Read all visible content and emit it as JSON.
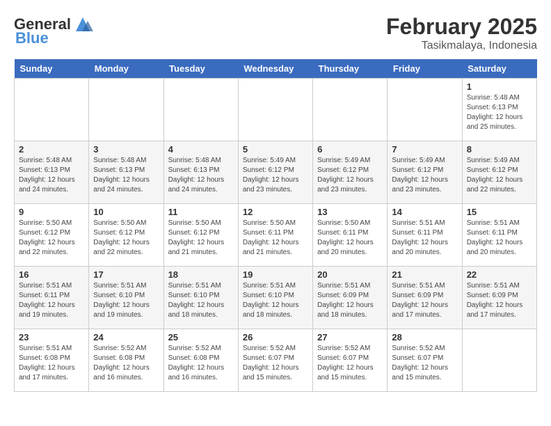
{
  "header": {
    "logo_general": "General",
    "logo_blue": "Blue",
    "month": "February 2025",
    "location": "Tasikmalaya, Indonesia"
  },
  "days_of_week": [
    "Sunday",
    "Monday",
    "Tuesday",
    "Wednesday",
    "Thursday",
    "Friday",
    "Saturday"
  ],
  "weeks": [
    [
      {
        "day": "",
        "info": ""
      },
      {
        "day": "",
        "info": ""
      },
      {
        "day": "",
        "info": ""
      },
      {
        "day": "",
        "info": ""
      },
      {
        "day": "",
        "info": ""
      },
      {
        "day": "",
        "info": ""
      },
      {
        "day": "1",
        "info": "Sunrise: 5:48 AM\nSunset: 6:13 PM\nDaylight: 12 hours\nand 25 minutes."
      }
    ],
    [
      {
        "day": "2",
        "info": "Sunrise: 5:48 AM\nSunset: 6:13 PM\nDaylight: 12 hours\nand 24 minutes."
      },
      {
        "day": "3",
        "info": "Sunrise: 5:48 AM\nSunset: 6:13 PM\nDaylight: 12 hours\nand 24 minutes."
      },
      {
        "day": "4",
        "info": "Sunrise: 5:48 AM\nSunset: 6:13 PM\nDaylight: 12 hours\nand 24 minutes."
      },
      {
        "day": "5",
        "info": "Sunrise: 5:49 AM\nSunset: 6:12 PM\nDaylight: 12 hours\nand 23 minutes."
      },
      {
        "day": "6",
        "info": "Sunrise: 5:49 AM\nSunset: 6:12 PM\nDaylight: 12 hours\nand 23 minutes."
      },
      {
        "day": "7",
        "info": "Sunrise: 5:49 AM\nSunset: 6:12 PM\nDaylight: 12 hours\nand 23 minutes."
      },
      {
        "day": "8",
        "info": "Sunrise: 5:49 AM\nSunset: 6:12 PM\nDaylight: 12 hours\nand 22 minutes."
      }
    ],
    [
      {
        "day": "9",
        "info": "Sunrise: 5:50 AM\nSunset: 6:12 PM\nDaylight: 12 hours\nand 22 minutes."
      },
      {
        "day": "10",
        "info": "Sunrise: 5:50 AM\nSunset: 6:12 PM\nDaylight: 12 hours\nand 22 minutes."
      },
      {
        "day": "11",
        "info": "Sunrise: 5:50 AM\nSunset: 6:12 PM\nDaylight: 12 hours\nand 21 minutes."
      },
      {
        "day": "12",
        "info": "Sunrise: 5:50 AM\nSunset: 6:11 PM\nDaylight: 12 hours\nand 21 minutes."
      },
      {
        "day": "13",
        "info": "Sunrise: 5:50 AM\nSunset: 6:11 PM\nDaylight: 12 hours\nand 20 minutes."
      },
      {
        "day": "14",
        "info": "Sunrise: 5:51 AM\nSunset: 6:11 PM\nDaylight: 12 hours\nand 20 minutes."
      },
      {
        "day": "15",
        "info": "Sunrise: 5:51 AM\nSunset: 6:11 PM\nDaylight: 12 hours\nand 20 minutes."
      }
    ],
    [
      {
        "day": "16",
        "info": "Sunrise: 5:51 AM\nSunset: 6:11 PM\nDaylight: 12 hours\nand 19 minutes."
      },
      {
        "day": "17",
        "info": "Sunrise: 5:51 AM\nSunset: 6:10 PM\nDaylight: 12 hours\nand 19 minutes."
      },
      {
        "day": "18",
        "info": "Sunrise: 5:51 AM\nSunset: 6:10 PM\nDaylight: 12 hours\nand 18 minutes."
      },
      {
        "day": "19",
        "info": "Sunrise: 5:51 AM\nSunset: 6:10 PM\nDaylight: 12 hours\nand 18 minutes."
      },
      {
        "day": "20",
        "info": "Sunrise: 5:51 AM\nSunset: 6:09 PM\nDaylight: 12 hours\nand 18 minutes."
      },
      {
        "day": "21",
        "info": "Sunrise: 5:51 AM\nSunset: 6:09 PM\nDaylight: 12 hours\nand 17 minutes."
      },
      {
        "day": "22",
        "info": "Sunrise: 5:51 AM\nSunset: 6:09 PM\nDaylight: 12 hours\nand 17 minutes."
      }
    ],
    [
      {
        "day": "23",
        "info": "Sunrise: 5:51 AM\nSunset: 6:08 PM\nDaylight: 12 hours\nand 17 minutes."
      },
      {
        "day": "24",
        "info": "Sunrise: 5:52 AM\nSunset: 6:08 PM\nDaylight: 12 hours\nand 16 minutes."
      },
      {
        "day": "25",
        "info": "Sunrise: 5:52 AM\nSunset: 6:08 PM\nDaylight: 12 hours\nand 16 minutes."
      },
      {
        "day": "26",
        "info": "Sunrise: 5:52 AM\nSunset: 6:07 PM\nDaylight: 12 hours\nand 15 minutes."
      },
      {
        "day": "27",
        "info": "Sunrise: 5:52 AM\nSunset: 6:07 PM\nDaylight: 12 hours\nand 15 minutes."
      },
      {
        "day": "28",
        "info": "Sunrise: 5:52 AM\nSunset: 6:07 PM\nDaylight: 12 hours\nand 15 minutes."
      },
      {
        "day": "",
        "info": ""
      }
    ]
  ]
}
